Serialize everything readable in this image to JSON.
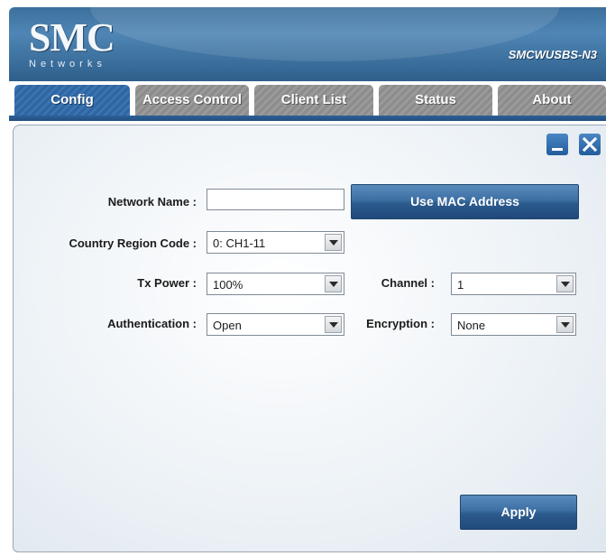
{
  "header": {
    "logo_main": "SMC",
    "logo_sub": "Networks",
    "model": "SMCWUSBS-N3"
  },
  "tabs": [
    {
      "label": "Config",
      "active": true
    },
    {
      "label": "Access Control",
      "active": false
    },
    {
      "label": "Client List",
      "active": false
    },
    {
      "label": "Status",
      "active": false
    },
    {
      "label": "About",
      "active": false
    }
  ],
  "window_controls": {
    "minimize_icon": "minimize-icon",
    "close_icon": "close-icon"
  },
  "form": {
    "network_name": {
      "label": "Network Name :",
      "value": ""
    },
    "use_mac_button": "Use MAC Address",
    "country_region": {
      "label": "Country Region Code :",
      "value": "0: CH1-11"
    },
    "tx_power": {
      "label": "Tx Power :",
      "value": "100%"
    },
    "channel": {
      "label": "Channel :",
      "value": "1"
    },
    "authentication": {
      "label": "Authentication :",
      "value": "Open"
    },
    "encryption": {
      "label": "Encryption :",
      "value": "None"
    },
    "apply_button": "Apply"
  },
  "colors": {
    "accent": "#2f65a0",
    "tab_inactive": "#8c8c8c",
    "header": "#3c6f9c"
  }
}
